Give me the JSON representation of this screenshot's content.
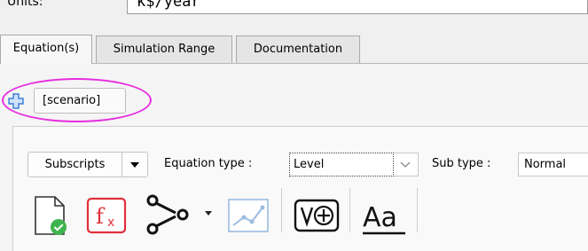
{
  "units": {
    "label": "Units:",
    "value": "k$/year"
  },
  "tabs": [
    {
      "label": "Equation(s)",
      "active": true
    },
    {
      "label": "Simulation Range",
      "active": false
    },
    {
      "label": "Documentation",
      "active": false
    }
  ],
  "scenario": {
    "add_icon": "plus-icon",
    "label": "[scenario]",
    "highlight_color": "#e62ee0"
  },
  "equation": {
    "subscripts_label": "Subscripts",
    "equation_type_label": "Equation type :",
    "equation_type_value": "Level",
    "sub_type_label": "Sub type :",
    "sub_type_value": "Normal"
  },
  "toolbar_icons": [
    "check-document-icon",
    "function-icon",
    "causal-tree-icon",
    "graph-icon",
    "add-variable-icon",
    "font-icon"
  ],
  "colors": {
    "function_red": "#e0303a",
    "check_green": "#3fb34f",
    "plus_blue": "#3b7dd8"
  }
}
